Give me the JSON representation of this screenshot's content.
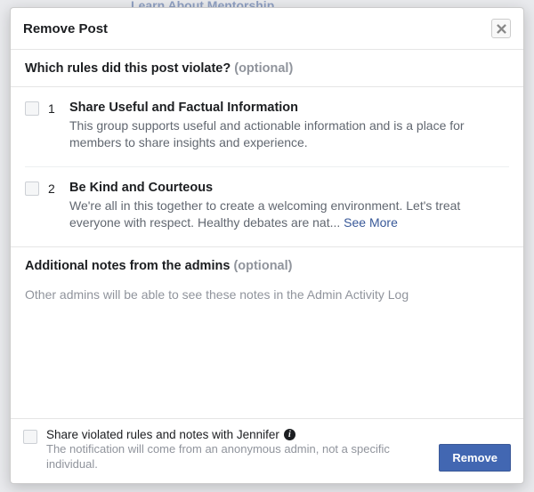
{
  "background": {
    "link_text": "Learn About Mentorship"
  },
  "dialog": {
    "title": "Remove Post",
    "rules_header": {
      "question": "Which rules did this post violate?",
      "optional_label": "(optional)"
    },
    "rules": [
      {
        "num": "1",
        "title": "Share Useful and Factual Information",
        "desc": "This group supports useful and actionable information and is a place for members to share insights and experience."
      },
      {
        "num": "2",
        "title": "Be Kind and Courteous",
        "desc": "We're all in this together to create a welcoming environment. Let's treat everyone with respect. Healthy debates are nat...",
        "see_more": "See More"
      }
    ],
    "notes": {
      "heading": "Additional notes from the admins",
      "optional_label": "(optional)",
      "help": "Other admins will be able to see these notes in the Admin Activity Log"
    },
    "footer": {
      "share_label": "Share violated rules and notes with Jennifer",
      "share_sub": "The notification will come from an anonymous admin, not a specific individual.",
      "remove_button": "Remove"
    }
  }
}
